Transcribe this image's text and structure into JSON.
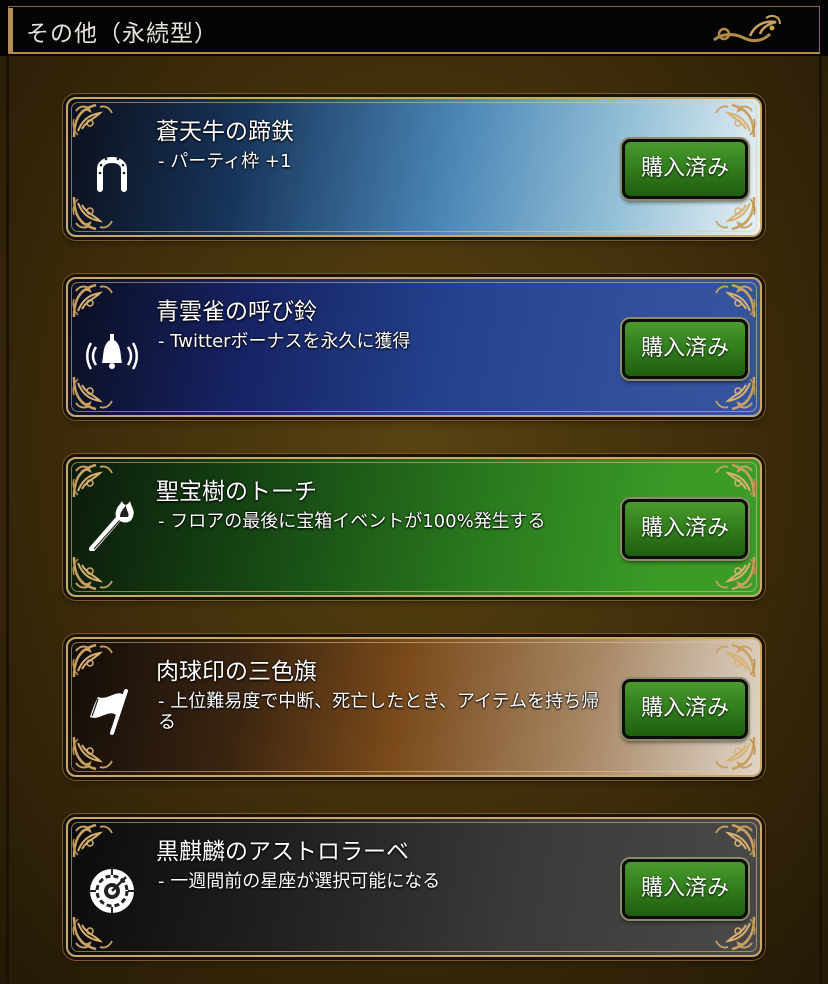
{
  "header": {
    "title": "その他（永続型）"
  },
  "items": [
    {
      "title": "蒼天牛の蹄鉄",
      "description": "- パーティ枠 +1",
      "button_label": "購入済み",
      "icon": "horseshoe-icon"
    },
    {
      "title": "青雲雀の呼び鈴",
      "description": "- Twitterボーナスを永久に獲得",
      "button_label": "購入済み",
      "icon": "bell-icon"
    },
    {
      "title": "聖宝樹のトーチ",
      "description": "- フロアの最後に宝箱イベントが100%発生する",
      "button_label": "購入済み",
      "icon": "torch-icon"
    },
    {
      "title": "肉球印の三色旗",
      "description": "- 上位難易度で中断、死亡したとき、アイテムを持ち帰る",
      "button_label": "購入済み",
      "icon": "flag-icon"
    },
    {
      "title": "黒麒麟のアストロラーベ",
      "description": "- 一週間前の星座が選択可能になる",
      "button_label": "購入済み",
      "icon": "astrolabe-icon"
    }
  ],
  "colors": {
    "button": "#33801e",
    "frame_gold": "#c9a868",
    "header_bg": "#050505"
  }
}
